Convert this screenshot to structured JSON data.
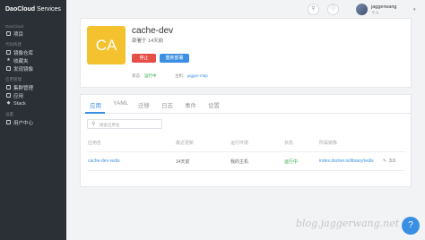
{
  "sidebar": {
    "brand_bold": "DaoCloud",
    "brand_rest": " Services",
    "sections": [
      {
        "title": "DaoCloud",
        "items": [
          {
            "icon": "folder-icon",
            "glyph": "",
            "label": "项目"
          }
        ]
      },
      {
        "title": "代码构建",
        "items": [
          {
            "icon": "image-repo-icon",
            "glyph": "",
            "label": "镜像仓库"
          },
          {
            "icon": "star-icon",
            "glyph": "★",
            "label": "收藏夹"
          },
          {
            "icon": "discover-icon",
            "glyph": "",
            "label": "发现镜像"
          }
        ]
      },
      {
        "title": "应用管理",
        "items": [
          {
            "icon": "cluster-icon",
            "glyph": "",
            "label": "集群管理"
          },
          {
            "icon": "app-icon",
            "glyph": "",
            "label": "应用"
          },
          {
            "icon": "stack-icon",
            "glyph": "◆",
            "label": "Stack"
          }
        ]
      },
      {
        "title": "设置",
        "items": [
          {
            "icon": "user-icon",
            "glyph": "",
            "label": "用户中心"
          }
        ]
      }
    ]
  },
  "topbar": {
    "icon1": "⚲",
    "icon2": "ⓘ",
    "username": "jaggerwang",
    "org": "个人"
  },
  "app": {
    "logo_text": "CA",
    "name": "cache-dev",
    "deploy_time": "部署于 14天前",
    "stop_label": "停止",
    "redeploy_label": "重新部署",
    "status_label": "状态:",
    "status_value": "运行中",
    "host_label": "主机:",
    "host_value": "jagger-mbp"
  },
  "tabs": [
    "应用",
    "YAML",
    "迁移",
    "日志",
    "事件",
    "设置"
  ],
  "search": {
    "placeholder": "搜索应用名"
  },
  "table": {
    "headers": [
      "应用名",
      "最近更新",
      "运行环境",
      "状态",
      "所属镜像"
    ],
    "rows": [
      [
        "cache-dev-redis",
        "14天前",
        "我的主机",
        "运行中",
        "index.docker.io/library/redis",
        "3.0"
      ]
    ]
  },
  "watermark": "blog.jaggerwang.net",
  "help_glyph": "?"
}
